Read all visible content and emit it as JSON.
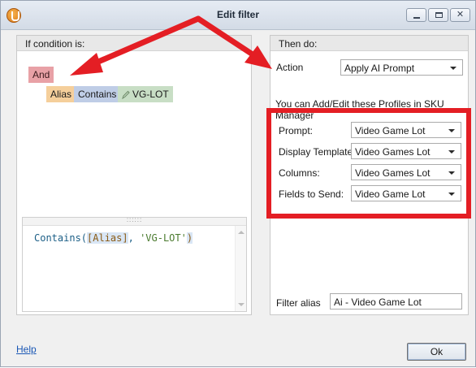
{
  "window": {
    "title": "Edit filter"
  },
  "left_panel": {
    "header": "If condition is:",
    "root_operator": "And",
    "condition": {
      "field": "Alias",
      "operator": "Contains",
      "value": "VG-LOT"
    },
    "expression": {
      "func": "Contains",
      "open": "(",
      "field": "[Alias]",
      "sep": ", ",
      "value": "'VG-LOT'",
      "close": ")"
    }
  },
  "right_panel": {
    "header": "Then do:",
    "action_label": "Action",
    "action_value": "Apply AI Prompt",
    "profiles_note": "You can Add/Edit these Profiles in SKU Manager",
    "prompt_label": "Prompt:",
    "prompt_value": "Video Game Lot",
    "display_template_label": "Display Template:",
    "display_template_value": "Video Games Lot",
    "columns_label": "Columns:",
    "columns_value": "Video Games Lot",
    "fields_label": "Fields to Send:",
    "fields_value": "Video Game Lot",
    "alias_label": "Filter alias",
    "alias_value": "Ai - Video Game Lot"
  },
  "footer": {
    "help_label": "Help",
    "ok_label": "Ok"
  },
  "icons": {
    "app": "app-logo-icon",
    "minimize": "minimize-icon",
    "maximize": "maximize-icon",
    "close": "close-icon",
    "pencil": "pencil-icon",
    "dropdown": "chevron-down-icon"
  },
  "colors": {
    "annotation": "#e41e24",
    "tag_and": "#e8a1a6",
    "tag_field": "#f5cf9b",
    "tag_operator": "#bfcde6",
    "tag_value": "#c8dec5"
  }
}
